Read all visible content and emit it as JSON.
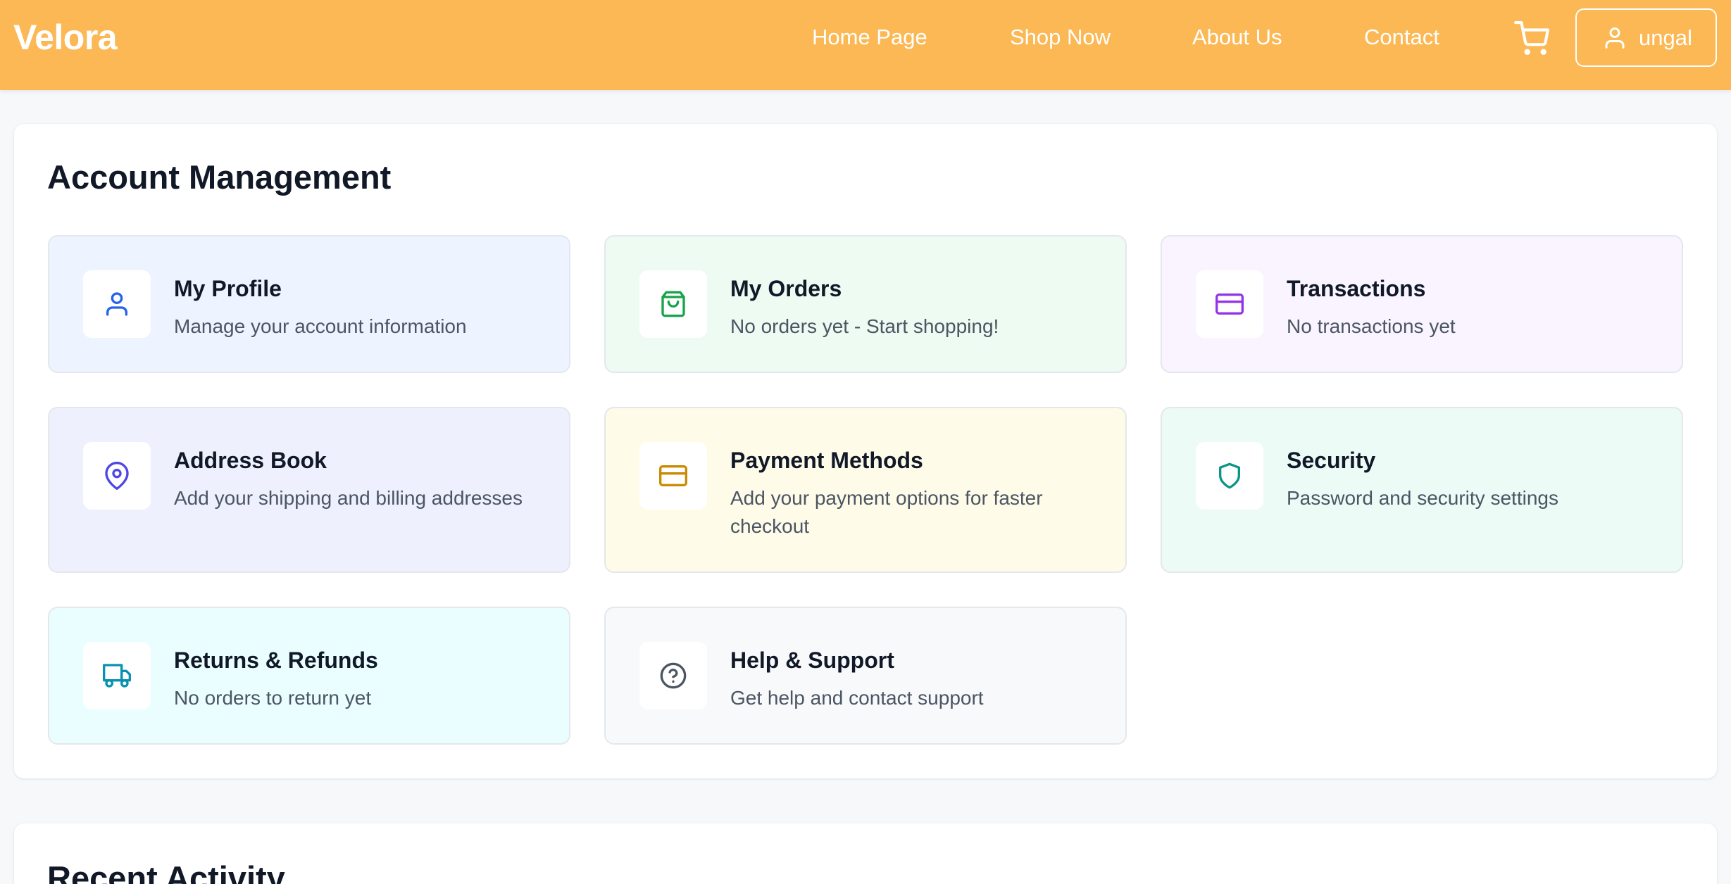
{
  "header": {
    "brand": "Velora",
    "nav": {
      "home": "Home Page",
      "shop": "Shop Now",
      "about": "About Us",
      "contact": "Contact"
    },
    "cart_icon": "cart-icon",
    "user": {
      "icon": "user-icon",
      "name": "ungal"
    },
    "background_color": "#fbb855"
  },
  "account": {
    "title": "Account Management",
    "tiles": [
      {
        "title": "My Profile",
        "description": "Manage your account information",
        "icon": "user-icon",
        "icon_color": "#2563eb",
        "background": "#eef4ff"
      },
      {
        "title": "My Orders",
        "description": "No orders yet - Start shopping!",
        "icon": "shopping-bag-icon",
        "icon_color": "#16a34a",
        "background": "#edfbf2"
      },
      {
        "title": "Transactions",
        "description": "No transactions yet",
        "icon": "credit-card-icon",
        "icon_color": "#9333ea",
        "background": "#f9f4ff"
      },
      {
        "title": "Address Book",
        "description": "Add your shipping and billing addresses",
        "icon": "map-pin-icon",
        "icon_color": "#4f46e5",
        "background": "#eef0fd"
      },
      {
        "title": "Payment Methods",
        "description": "Add your payment options for faster checkout",
        "icon": "credit-card-icon",
        "icon_color": "#ca8a04",
        "background": "#fefbe8"
      },
      {
        "title": "Security",
        "description": "Password and security settings",
        "icon": "shield-icon",
        "icon_color": "#0d9488",
        "background": "#ecfbf6"
      },
      {
        "title": "Returns & Refunds",
        "description": "No orders to return yet",
        "icon": "truck-icon",
        "icon_color": "#0891b2",
        "background": "#eafeff"
      },
      {
        "title": "Help & Support",
        "description": "Get help and contact support",
        "icon": "help-circle-icon",
        "icon_color": "#4b5563",
        "background": "#f8f9fb"
      }
    ]
  },
  "recent_activity": {
    "title": "Recent Activity"
  }
}
